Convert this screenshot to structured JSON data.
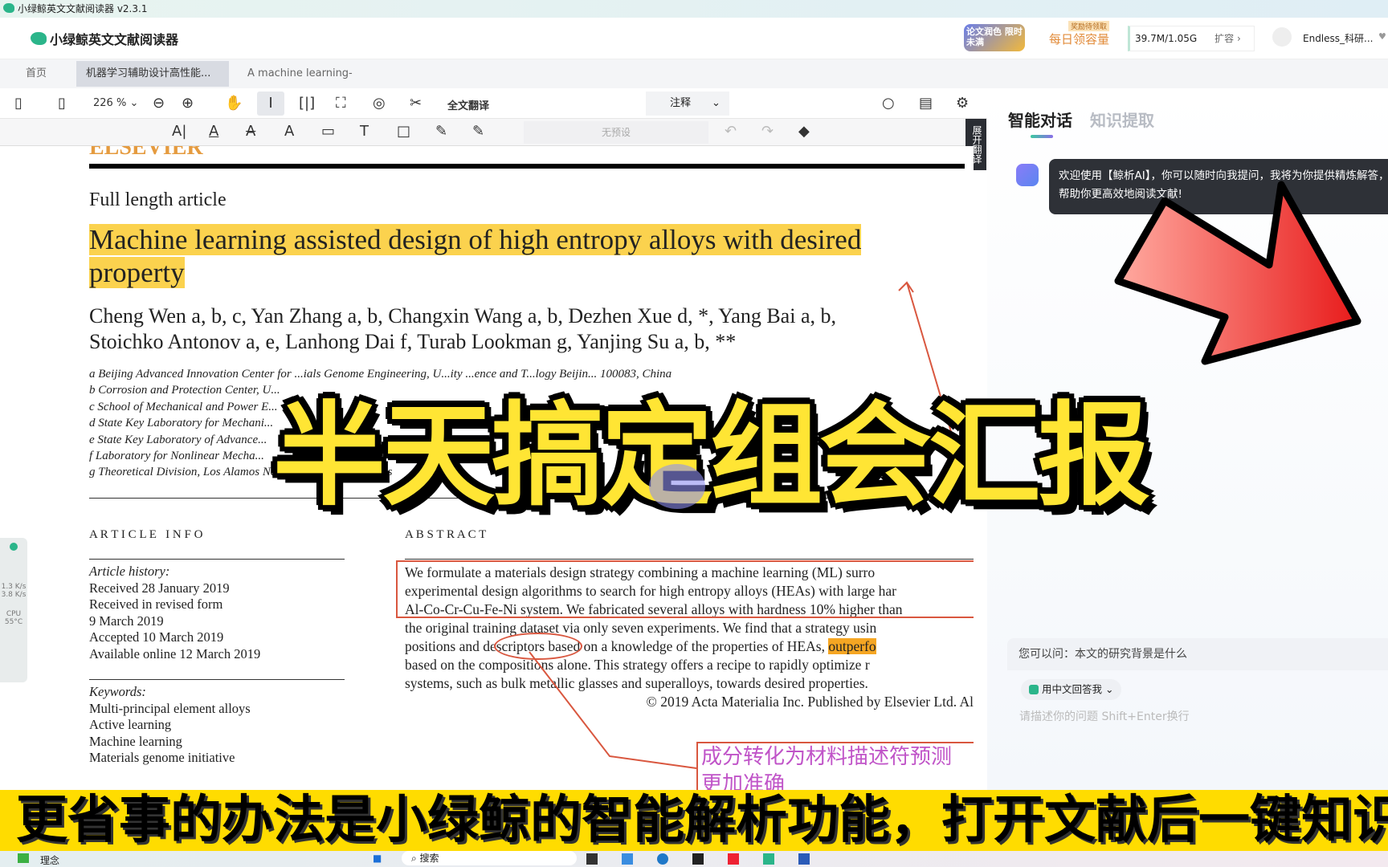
{
  "window": {
    "title": "小绿鲸英文文献阅读器 v2.3.1"
  },
  "header": {
    "app_name": "小绿鲸英文文献阅读器",
    "promo": "论文润色 限时未满",
    "reward_badge": "奖励待领取",
    "daily": "每日领容量",
    "storage": "39.7M/1.05G",
    "expand": "扩容 ›",
    "user": "Endless_科研..."
  },
  "tabs": [
    {
      "label": "首页"
    },
    {
      "label": "机器学习辅助设计高性能...",
      "close": "×"
    },
    {
      "label": "A machine learning-base...",
      "close": "×"
    }
  ],
  "toolbar": {
    "zoom": "226 %",
    "full_translate": "全文翻译",
    "mode": "注释"
  },
  "annotation": {
    "preset": "无预设",
    "expand_translate": "展开翻译"
  },
  "paper": {
    "journal_logo": "ELSEVIER",
    "type": "Full length article",
    "title_line1": "Machine learning assisted design of high entropy alloys with desired",
    "title_line2": "property",
    "authors_line1": "Cheng Wen a, b, c, Yan Zhang a, b, Changxin Wang a, b, Dezhen Xue d, *, Yang Bai a, b,",
    "authors_line2": "Stoichko Antonov a, e, Lanhong Dai f, Turab Lookman g, Yanjing Su a, b, **",
    "affiliations": [
      "a Beijing Advanced Innovation Center for ...ials Genome Engineering, U...ity ...ence and T...logy Beijin... 100083, China",
      "b Corrosion and Protection Center, U...",
      "c School of Mechanical and Power E...",
      "d State Key Laboratory for Mechani...",
      "e State Key Laboratory of Advance...",
      "f Laboratory for Nonlinear Mecha...",
      "g Theoretical Division, Los Alamos Nation... ...oratory, ...amos"
    ],
    "article_info_heading": "A R T I C L E   I N F O",
    "abstract_heading": "A B S T R A C T",
    "history": [
      "Article history:",
      "Received 28 January 2019",
      "Received in revised form",
      "9 March 2019",
      "Accepted 10 March 2019",
      "Available online 12 March 2019"
    ],
    "keywords": [
      "Keywords:",
      "Multi-principal element alloys",
      "Active learning",
      "Machine learning",
      "Materials genome initiative"
    ],
    "abstract": [
      "We formulate a materials design strategy combining a machine learning (ML) surro",
      "experimental design algorithms to search for high entropy alloys (HEAs) with large har",
      "Al-Co-Cr-Cu-Fe-Ni system. We fabricated several alloys with hardness 10% higher than",
      "the original training dataset via only seven experiments. We find that a strategy usin",
      "positions and descriptors based on a knowledge of the properties of HEAs, ",
      "based on the compositions alone. This strategy offers a recipe to rapidly optimize r",
      "systems, such as bulk metallic glasses and superalloys, towards desired properties."
    ],
    "abstract_highlight": "outperfo",
    "copyright": "© 2019 Acta Materialia Inc. Published by Elsevier Ltd. Al",
    "note": "成分转化为材料描述符预测",
    "note2": "更加准确"
  },
  "ai_panel": {
    "tabs": [
      "智能对话",
      "知识提取"
    ],
    "welcome": "欢迎使用【鲸析AI】，你可以随时向我提问，我将为你提供精炼解答，帮助你更高效地阅读文献!",
    "suggest": "您可以问：本文的研究背景是什么",
    "lang": "用中文回答我",
    "input_placeholder": "请描述你的问题 Shift+Enter换行"
  },
  "sidebar_widget": {
    "net1": "1.3 K/s",
    "net2": "3.8 K/s",
    "cpu": "CPU 55°C"
  },
  "overlay_title": "半天搞定组会汇报",
  "subtitle": "更省事的办法是小绿鲸的智能解析功能，打开文献后一键知识",
  "taskbar": {
    "weather": "理念",
    "search": "搜索"
  },
  "colors": {
    "highlight": "#fbd24e",
    "annotation": "#d9573f",
    "note_text": "#c054c8",
    "overlay": "#ffe534",
    "banner": "#ffdc00"
  }
}
